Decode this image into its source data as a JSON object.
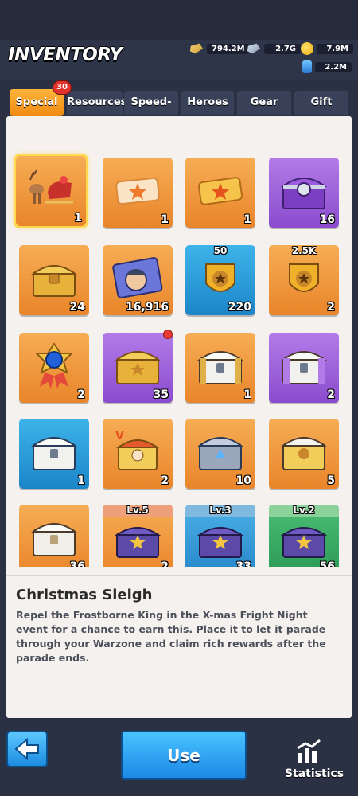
{
  "title": "INVENTORY",
  "resources": [
    {
      "name": "gold-bars",
      "value": "794.2M",
      "icon": "gold-bar-icon"
    },
    {
      "name": "steel",
      "value": "2.7G",
      "icon": "steel-bar-icon"
    },
    {
      "name": "coins",
      "value": "7.9M",
      "icon": "coin-icon"
    },
    {
      "name": "oil",
      "value": "2.2M",
      "icon": "oil-barrel-icon"
    }
  ],
  "tabs": [
    {
      "label": "Special",
      "active": true
    },
    {
      "label": "Resources"
    },
    {
      "label": "Speed-up"
    },
    {
      "label": "Heroes"
    },
    {
      "label": "Gear"
    },
    {
      "label": "Gift"
    }
  ],
  "special_badge": "30",
  "items": [
    {
      "name": "christmas-sleigh",
      "count": "1",
      "color": "orange",
      "icon": "sleigh-icon",
      "selected": true
    },
    {
      "name": "ticket-star",
      "count": "1",
      "color": "orange",
      "icon": "ticket-icon"
    },
    {
      "name": "ticket-gold",
      "count": "1",
      "color": "orange",
      "icon": "ticket-icon"
    },
    {
      "name": "purple-chest",
      "count": "16",
      "color": "purple",
      "icon": "chest-icon"
    },
    {
      "name": "gold-chest",
      "count": "24",
      "color": "orange",
      "icon": "chest-icon"
    },
    {
      "name": "hero-card",
      "count": "16,916",
      "color": "orange",
      "icon": "hero-card-icon"
    },
    {
      "name": "badge-50",
      "count": "220",
      "color": "blue",
      "icon": "badge-icon",
      "top": "50"
    },
    {
      "name": "badge-2-5k",
      "count": "2",
      "color": "orange",
      "icon": "badge-icon",
      "top": "2.5K"
    },
    {
      "name": "medal",
      "count": "2",
      "color": "orange",
      "icon": "medal-icon"
    },
    {
      "name": "gold-crate",
      "count": "35",
      "color": "purple",
      "icon": "chest-icon",
      "dot": true
    },
    {
      "name": "silver-chest",
      "count": "1",
      "color": "orange",
      "icon": "chest-icon"
    },
    {
      "name": "silver-chest-purple",
      "count": "2",
      "color": "purple",
      "icon": "chest-icon"
    },
    {
      "name": "silver-chest-blue",
      "count": "1",
      "color": "blue",
      "icon": "chest-icon"
    },
    {
      "name": "v-chest",
      "count": "2",
      "color": "orange",
      "icon": "chest-icon"
    },
    {
      "name": "steel-chest",
      "count": "10",
      "color": "orange",
      "icon": "chest-icon"
    },
    {
      "name": "white-gold-chest",
      "count": "5",
      "color": "orange",
      "icon": "chest-icon"
    },
    {
      "name": "white-chest",
      "count": "36",
      "color": "orange",
      "icon": "chest-icon"
    },
    {
      "name": "lv5-chest",
      "count": "2",
      "color": "lv-o",
      "icon": "chest-icon",
      "top": "Lv.5"
    },
    {
      "name": "lv3-chest",
      "count": "33",
      "color": "lv-b",
      "icon": "chest-icon",
      "top": "Lv.3"
    },
    {
      "name": "lv2-chest",
      "count": "56",
      "color": "lv-g",
      "icon": "chest-icon",
      "top": "Lv.2"
    }
  ],
  "detail": {
    "title": "Christmas Sleigh",
    "text": "Repel the Frostborne King in the X-mas Fright Night event for a chance to earn this. Place it to let it parade through your Warzone and claim rich rewards after the parade ends."
  },
  "buttons": {
    "back_icon": "back-arrow-icon",
    "use": "Use",
    "statistics": "Statistics"
  }
}
